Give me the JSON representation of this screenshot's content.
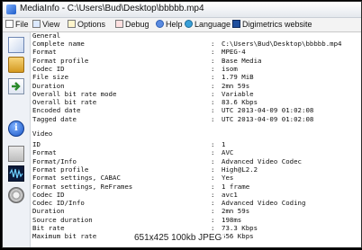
{
  "window": {
    "title": "MediaInfo - C:\\Users\\Bud\\Desktop\\bbbbb.mp4"
  },
  "menu": [
    {
      "id": "file",
      "label": "File"
    },
    {
      "id": "view",
      "label": "View"
    },
    {
      "id": "options",
      "label": "Options"
    },
    {
      "id": "debug",
      "label": "Debug"
    },
    {
      "id": "help",
      "label": "Help"
    },
    {
      "id": "language",
      "label": "Language"
    },
    {
      "id": "digimetrics",
      "label": "Digimetrics website"
    }
  ],
  "sidebar_icons": [
    "open-file-icon",
    "folder-icon",
    "export-icon",
    "info-icon",
    "video-info-icon",
    "waveform-icon",
    "gear-icon"
  ],
  "general": {
    "header": "General",
    "rows": [
      {
        "label": "Complete name",
        "value": "C:\\Users\\Bud\\Desktop\\bbbbb.mp4"
      },
      {
        "label": "Format",
        "value": "MPEG-4"
      },
      {
        "label": "Format profile",
        "value": "Base Media"
      },
      {
        "label": "Codec ID",
        "value": "isom"
      },
      {
        "label": "File size",
        "value": "1.79 MiB"
      },
      {
        "label": "Duration",
        "value": "2mn 59s"
      },
      {
        "label": "Overall bit rate mode",
        "value": "Variable"
      },
      {
        "label": "Overall bit rate",
        "value": "83.6 Kbps"
      },
      {
        "label": "Encoded date",
        "value": "UTC 2013-04-09 01:02:08"
      },
      {
        "label": "Tagged date",
        "value": "UTC 2013-04-09 01:02:08"
      }
    ]
  },
  "video": {
    "header": "Video",
    "rows": [
      {
        "label": "ID",
        "value": "1"
      },
      {
        "label": "Format",
        "value": "AVC"
      },
      {
        "label": "Format/Info",
        "value": "Advanced Video Codec"
      },
      {
        "label": "Format profile",
        "value": "High@L2.2"
      },
      {
        "label": "Format settings, CABAC",
        "value": "Yes"
      },
      {
        "label": "Format settings, ReFrames",
        "value": "1 frame"
      },
      {
        "label": "Codec ID",
        "value": "avc1"
      },
      {
        "label": "Codec ID/Info",
        "value": "Advanced Video Coding"
      },
      {
        "label": "Duration",
        "value": "2mn 59s"
      },
      {
        "label": "Source duration",
        "value": "198ms"
      },
      {
        "label": "Bit rate",
        "value": "73.3 Kbps"
      },
      {
        "label": "Maximum bit rate",
        "value": "556 Kbps"
      }
    ]
  },
  "cursor_glyph": "I",
  "watermark": "651x425 100kb JPEG"
}
